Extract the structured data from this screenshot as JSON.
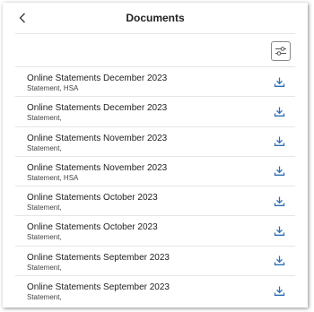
{
  "header": {
    "title": "Documents",
    "back_icon": "chevron-left-icon"
  },
  "toolbar": {
    "filter_icon": "sliders-icon"
  },
  "accent_color": "#2f6fb5",
  "documents": [
    {
      "title": "Online Statements December 2023",
      "subtitle": "Statement, HSA"
    },
    {
      "title": "Online Statements December 2023",
      "subtitle": "Statement,"
    },
    {
      "title": "Online Statements November 2023",
      "subtitle": "Statement,"
    },
    {
      "title": "Online Statements November 2023",
      "subtitle": "Statement, HSA"
    },
    {
      "title": "Online Statements October 2023",
      "subtitle": "Statement,"
    },
    {
      "title": "Online Statements October 2023",
      "subtitle": "Statement,"
    },
    {
      "title": "Online Statements September 2023",
      "subtitle": "Statement,"
    },
    {
      "title": "Online Statements September 2023",
      "subtitle": "Statement,"
    }
  ]
}
